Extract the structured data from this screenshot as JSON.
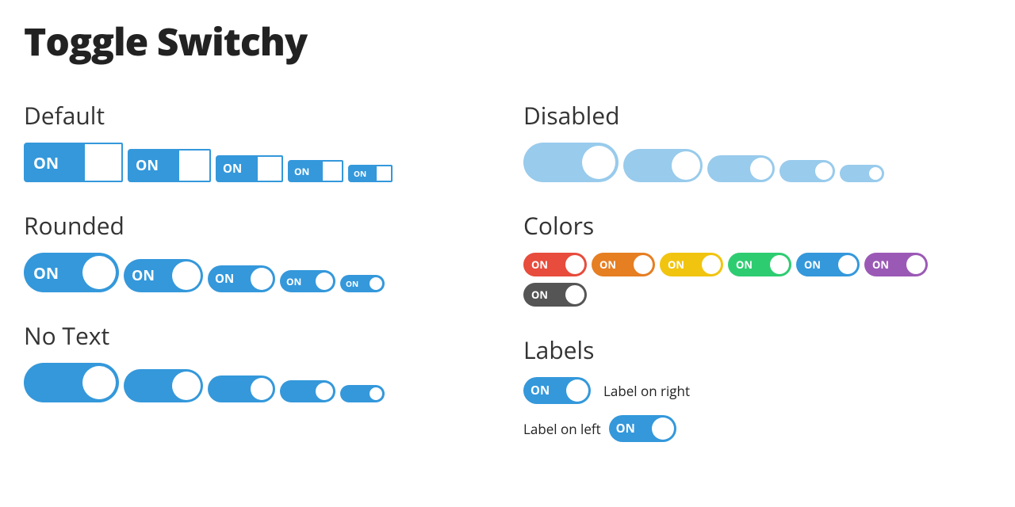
{
  "pageTitle": "Toggle Switchy",
  "onText": "ON",
  "sections": {
    "default": "Default",
    "rounded": "Rounded",
    "noText": "No Text",
    "disabled": "Disabled",
    "colors": "Colors",
    "labels": "Labels"
  },
  "colorSwatches": {
    "red": "#e74c3c",
    "orange": "#e67e22",
    "yellow": "#f1c40f",
    "green": "#2ecc71",
    "blue": "#3498db",
    "purple": "#9b59b6",
    "gray": "#555555"
  },
  "labels": {
    "right": "Label on right",
    "left": "Label on left"
  }
}
